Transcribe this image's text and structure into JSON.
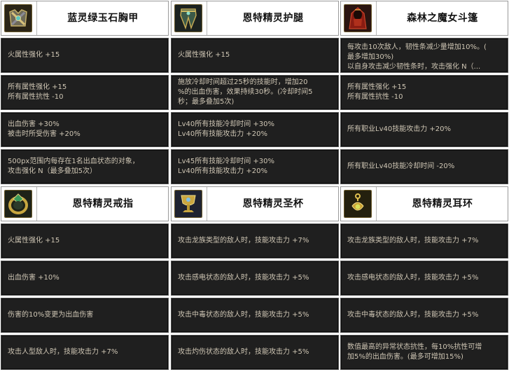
{
  "columns_top": [
    {
      "title": "蓝灵绿玉石胸甲",
      "icon": "chest-armor-icon",
      "rows": [
        "火属性强化 +15",
        "所有属性强化 +15\n所有属性抗性 -10",
        "出血伤害 +30%\n被击时所受伤害 +20%",
        "500px范围内每存在1名出血状态的对象，\n攻击强化 N（最多叠加5次）"
      ]
    },
    {
      "title": "恩特精灵护腿",
      "icon": "leg-armor-icon",
      "rows": [
        "火属性强化 +15",
        "施放冷却时间超过25秒的技能时，增加20\n%的出血伤害，效果持续30秒。(冷却时间5\n秒；最多叠加5次)",
        "Lv40所有技能冷却时间 +30%\nLv40所有技能攻击力 +20%",
        "Lv45所有技能冷却时间 +30%\nLv40所有技能攻击力 +20%"
      ]
    },
    {
      "title": "森林之魔女斗篷",
      "icon": "witch-cloak-icon",
      "rows": [
        "每攻击10次敌人，韧性条减少量增加10%。(\n最多增加30%)\n以自身攻击减少韧性条时，攻击强化 N（...",
        "所有属性强化 +15\n所有属性抗性 -10",
        "所有职业Lv40技能攻击力 +20%",
        "所有职业Lv40技能冷却时间 -20%"
      ]
    }
  ],
  "columns_bottom": [
    {
      "title": "恩特精灵戒指",
      "icon": "elf-ring-icon",
      "rows": [
        "火属性强化 +15",
        "出血伤害 +10%",
        "伤害的10%变更为出血伤害",
        "攻击人型敌人时，技能攻击力 +7%"
      ]
    },
    {
      "title": "恩特精灵圣杯",
      "icon": "holy-grail-icon",
      "rows": [
        "攻击龙族类型的敌人时，技能攻击力 +7%",
        "攻击感电状态的敌人时，技能攻击力 +5%",
        "攻击中毒状态的敌人时，技能攻击力 +5%",
        "攻击灼伤状态的敌人时，技能攻击力 +5%"
      ]
    },
    {
      "title": "恩特精灵耳环",
      "icon": "elf-earring-icon",
      "rows": [
        "攻击龙族类型的敌人时，技能攻击力 +7%",
        "攻击感电状态的敌人时，技能攻击力 +5%",
        "攻击中毒状态的敌人时，技能攻击力 +5%",
        "数值最高的异常状态抗性，每10%抗性可增\n加5%的出血伤害。(最多可增加15%)"
      ]
    }
  ]
}
